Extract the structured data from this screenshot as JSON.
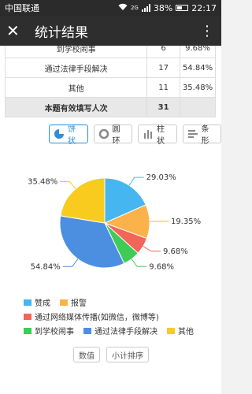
{
  "status_bar": {
    "carrier": "中国联通",
    "network": "2G",
    "battery": "38%",
    "time": "22:17"
  },
  "header": {
    "title": "统计结果"
  },
  "table": {
    "rows": [
      {
        "option": "到学校闹事",
        "count": "6",
        "percent": "9.68%"
      },
      {
        "option": "通过法律手段解决",
        "count": "17",
        "percent": "54.84%"
      },
      {
        "option": "其他",
        "count": "11",
        "percent": "35.48%"
      }
    ],
    "total": {
      "label": "本题有效填写人次",
      "count": "31"
    }
  },
  "chart_types": {
    "pie": "饼状",
    "ring": "圆环",
    "column": "柱状",
    "bar": "条形"
  },
  "sort_buttons": {
    "value": "数值",
    "sort": "小计排序"
  },
  "chart_data": {
    "type": "pie",
    "series": [
      {
        "name": "赞成",
        "percent": 29.03,
        "label": "29.03%",
        "color": "#45b6f0"
      },
      {
        "name": "报警",
        "percent": 19.35,
        "label": "19.35%",
        "color": "#fbb24a"
      },
      {
        "name": "通过网络媒体传播(如微信，微博等)",
        "percent": 9.68,
        "label": "9.68%",
        "color": "#f2665a"
      },
      {
        "name": "到学校闹事",
        "percent": 9.68,
        "label": "9.68%",
        "color": "#3fcb56"
      },
      {
        "name": "通过法律手段解决",
        "percent": 54.84,
        "label": "54.84%",
        "color": "#4c8fe0"
      },
      {
        "name": "其他",
        "percent": 35.48,
        "label": "35.48%",
        "color": "#f8cb1e"
      }
    ],
    "legend_position": "bottom"
  }
}
